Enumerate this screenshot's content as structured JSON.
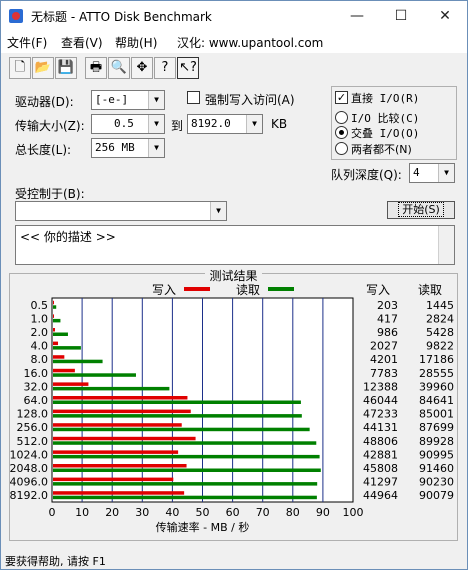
{
  "window": {
    "title": "无标题 - ATTO Disk Benchmark",
    "min": "—",
    "max": "☐",
    "close": "✕"
  },
  "menu": [
    {
      "label": "文件(F)"
    },
    {
      "label": "查看(V)"
    },
    {
      "label": "帮助(H)"
    },
    {
      "label": "汉化: www.upantool.com"
    }
  ],
  "toolbar": {
    "new": "🗋",
    "open": "📂",
    "save": "💾",
    "print": "🖶",
    "preview": "🔍",
    "move": "✥",
    "help": "?",
    "context_help": "↖?"
  },
  "form": {
    "drive_label": "驱动器(D):",
    "drive_value": "[-e-]",
    "transfer_label": "传输大小(Z):",
    "transfer_from": "0.5",
    "to_label": "到",
    "transfer_to": "8192.0",
    "kb_label": "KB",
    "length_label": "总长度(L):",
    "length_value": "256 MB",
    "force_write_label": "强制写入访问(A)",
    "direct_io_label": "直接 I/O(R)",
    "io_compare_label": "I/O 比较(C)",
    "overlapped_io_label": "交叠 I/O(O)",
    "neither_label": "两者都不(N)",
    "queue_label": "队列深度(Q):",
    "queue_value": "4",
    "controlled_by_label": "受控制于(B):",
    "controlled_by_value": "",
    "start_label": "开始(S)",
    "description": "<<  你的描述   >>"
  },
  "results": {
    "title": "测试结果",
    "write_legend": "写入",
    "read_legend": "读取",
    "write_header": "写入",
    "read_header": "读取"
  },
  "chart_data": {
    "type": "bar",
    "orientation": "horizontal",
    "title": "测试结果",
    "xlabel": "传输速率 - MB / 秒",
    "xlim": [
      0,
      100
    ],
    "xticks": [
      0,
      10,
      20,
      30,
      40,
      50,
      60,
      70,
      80,
      90,
      100
    ],
    "grid": true,
    "legend_position": "top",
    "categories": [
      "0.5",
      "1.0",
      "2.0",
      "4.0",
      "8.0",
      "16.0",
      "32.0",
      "64.0",
      "128.0",
      "256.0",
      "512.0",
      "1024.0",
      "2048.0",
      "4096.0",
      "8192.0"
    ],
    "series": [
      {
        "name": "写入",
        "color": "#e00000",
        "values": [
          0.2,
          0.4,
          1.0,
          2.0,
          4.1,
          7.6,
          12.1,
          45.0,
          46.1,
          43.1,
          47.7,
          41.9,
          44.7,
          40.3,
          43.9
        ]
      },
      {
        "name": "读取",
        "color": "#008000",
        "values": [
          1.4,
          2.8,
          5.3,
          9.6,
          16.8,
          27.9,
          39.0,
          82.7,
          83.0,
          85.6,
          87.8,
          88.9,
          89.3,
          88.1,
          88.0
        ]
      }
    ],
    "write_kb": [
      "203",
      "417",
      "986",
      "2027",
      "4201",
      "7783",
      "12388",
      "46044",
      "47233",
      "44131",
      "48806",
      "42881",
      "45808",
      "41297",
      "44964"
    ],
    "read_kb": [
      "1445",
      "2824",
      "5428",
      "9822",
      "17186",
      "28555",
      "39960",
      "84641",
      "85001",
      "87699",
      "89928",
      "90995",
      "91460",
      "90230",
      "90079"
    ]
  },
  "status": {
    "text": "要获得帮助, 请按 F1"
  }
}
